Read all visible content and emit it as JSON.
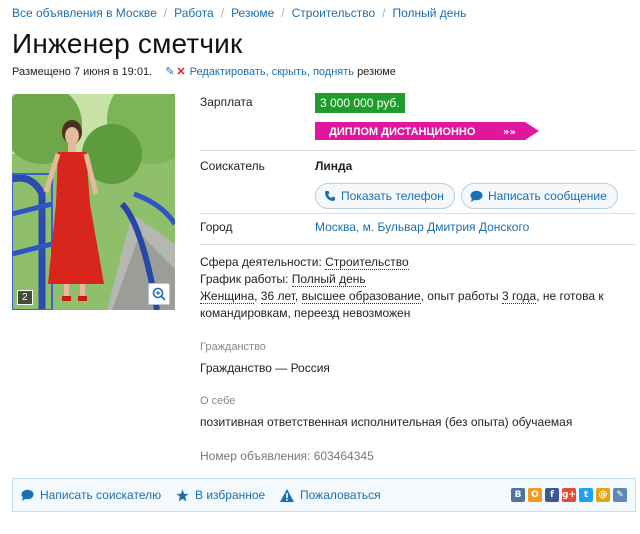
{
  "breadcrumbs": [
    "Все объявления в Москве",
    "Работа",
    "Резюме",
    "Строительство",
    "Полный день"
  ],
  "title": "Инженер сметчик",
  "posted": {
    "text": "Размещено 7 июня в 19:01.",
    "edit_link": "Редактировать, скрыть, поднять",
    "edit_suffix": "резюме"
  },
  "photo": {
    "count": "2"
  },
  "salary": {
    "label": "Зарплата",
    "value": "3 000 000 руб."
  },
  "promo": {
    "text": "ДИПЛОМ ДИСТАНЦИОННО",
    "color": "#e0169d"
  },
  "seeker": {
    "label": "Соискатель",
    "name": "Линда",
    "show_phone": "Показать телефон",
    "write_message": "Написать сообщение"
  },
  "city": {
    "label": "Город",
    "value": "Москва, м. Бульвар Дмитрия Донского"
  },
  "details": {
    "sphere_label": "Сфера деятельности: ",
    "sphere_value": "Строительство",
    "schedule_label": "График работы: ",
    "schedule_value": "Полный день",
    "gender": "Женщина",
    "age": "36 лет",
    "education": "высшее образование",
    "experience_prefix": ", опыт работы ",
    "experience_value": "3 года",
    "trips": ", не готова к командировкам, переезд невозможен"
  },
  "citizenship": {
    "label": "Гражданство",
    "value": "Гражданство — Россия"
  },
  "about": {
    "label": "О себе",
    "value": "позитивная ответственная исполнительная (без опыта) обучаемая"
  },
  "ad_number": "Номер объявления: 603464345",
  "bottom_bar": {
    "write": "Написать соискателю",
    "favorite": "В избранное",
    "complain": "Пожаловаться"
  },
  "shares": [
    {
      "name": "vk-icon",
      "glyph": "В",
      "color": "#4c75a3"
    },
    {
      "name": "odnoklassniki-icon",
      "glyph": "О",
      "color": "#f59a1b"
    },
    {
      "name": "facebook-icon",
      "glyph": "f",
      "color": "#3b5998"
    },
    {
      "name": "google-plus-icon",
      "glyph": "g+",
      "color": "#dd4b39"
    },
    {
      "name": "twitter-icon",
      "glyph": "t",
      "color": "#1da1f2"
    },
    {
      "name": "mailru-icon",
      "glyph": "@",
      "color": "#e8a20c"
    },
    {
      "name": "livejournal-icon",
      "glyph": "✎",
      "color": "#5d87b5"
    }
  ]
}
